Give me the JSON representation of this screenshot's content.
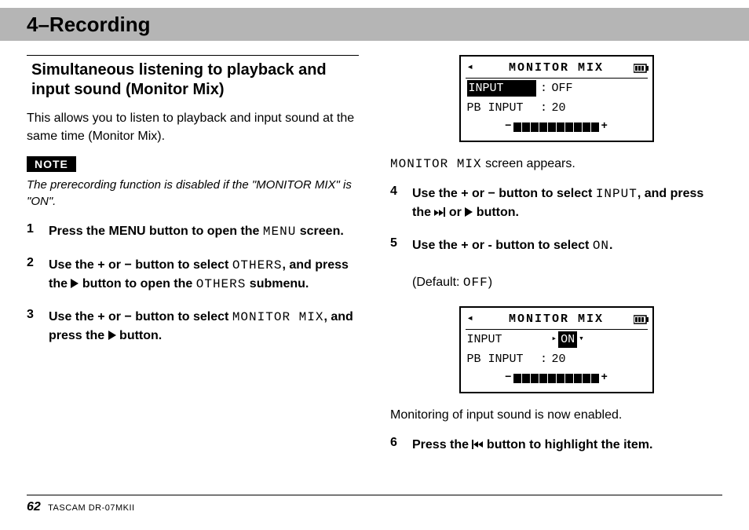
{
  "header": {
    "chapter": "4–Recording"
  },
  "section": {
    "heading": "Simultaneous listening to playback and input sound (Monitor Mix)",
    "intro": "This allows you to listen to playback and input sound at the same time (Monitor Mix).",
    "note_label": "NOTE",
    "note_text": "The prerecording function is disabled if the \"MONITOR MIX\" is \"ON\"."
  },
  "steps": {
    "s1_a": "Press the MENU button to open the ",
    "s1_menu": "MENU",
    "s1_b": " screen.",
    "s2_a": "Use the + or − button to select ",
    "s2_others1": "OTHERS",
    "s2_b": ", and press the ",
    "s2_c": " button to open the ",
    "s2_others2": "OTHERS",
    "s2_d": " submenu.",
    "s3_a": "Use the + or − button to select ",
    "s3_mm": "MONITOR MIX",
    "s3_b": ", and press the ",
    "s3_c": " button.",
    "r_caption1_a": "MONITOR MIX",
    "r_caption1_b": " screen appears.",
    "s4_a": "Use the + or − button to select ",
    "s4_input": "INPUT",
    "s4_b": ", and press the ",
    "s4_c": " or ",
    "s4_d": " button.",
    "s5_a": "Use the + or - button to select ",
    "s5_on": "ON",
    "s5_b": ".",
    "s5_default_a": "(Default: ",
    "s5_default_val": "OFF",
    "s5_default_b": ")",
    "r_caption2": "Monitoring of input sound is now enabled.",
    "s6_a": "Press the ",
    "s6_b": " button to highlight the item."
  },
  "lcd1": {
    "title": "MONITOR MIX",
    "row1_label": "INPUT",
    "row1_val": "OFF",
    "row2_label": "PB INPUT",
    "row2_val": "20"
  },
  "lcd2": {
    "title": "MONITOR MIX",
    "row1_label": "INPUT",
    "row1_val": "ON",
    "row2_label": "PB INPUT",
    "row2_val": "20"
  },
  "footer": {
    "page": "62",
    "model": "TASCAM DR-07MKII"
  }
}
